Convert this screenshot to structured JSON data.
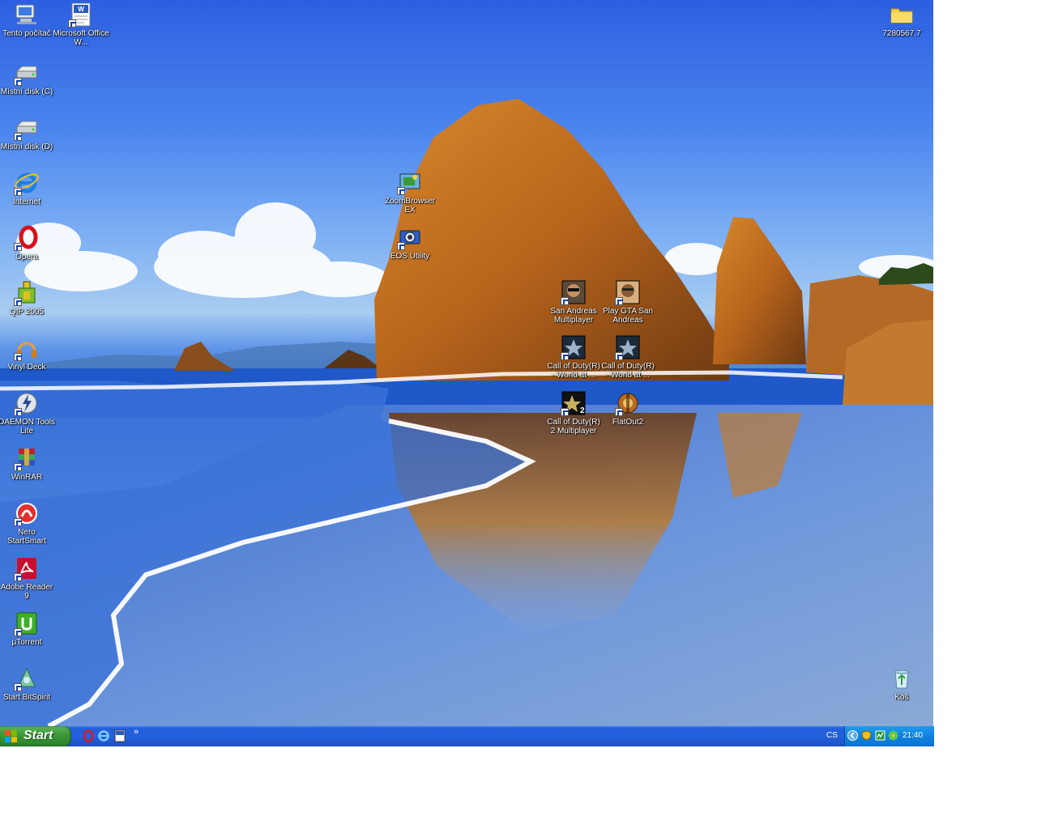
{
  "desktop": {
    "icons": [
      {
        "label": "Tento počítač",
        "icon": "my-computer-icon"
      },
      {
        "label": "Microsoft Office W...",
        "icon": "word-icon"
      },
      {
        "label": "Místní disk (C)",
        "icon": "hard-drive-icon"
      },
      {
        "label": "Místní disk (D)",
        "icon": "hard-drive-icon"
      },
      {
        "label": "Internet",
        "icon": "internet-explorer-icon"
      },
      {
        "label": "Opera",
        "icon": "opera-icon"
      },
      {
        "label": "QIP 2005",
        "icon": "qip-icon"
      },
      {
        "label": "Vinyl Deck",
        "icon": "headphones-icon"
      },
      {
        "label": "DAEMON Tools Lite",
        "icon": "daemon-tools-icon"
      },
      {
        "label": "WinRAR",
        "icon": "winrar-icon"
      },
      {
        "label": "Nero StartSmart",
        "icon": "nero-icon"
      },
      {
        "label": "Adobe Reader 9",
        "icon": "adobe-reader-icon"
      },
      {
        "label": "µTorrent",
        "icon": "utorrent-icon"
      },
      {
        "label": "Start BitSpirit",
        "icon": "bitspirit-icon"
      },
      {
        "label": "ZoomBrowser EX",
        "icon": "zoombrowser-icon"
      },
      {
        "label": "EOS Utility",
        "icon": "eos-utility-icon"
      },
      {
        "label": "San Andreas Multiplayer",
        "icon": "gta-icon"
      },
      {
        "label": "Play GTA San Andreas",
        "icon": "gta-icon"
      },
      {
        "label": "Call of Duty(R) - World at ...",
        "icon": "cod-icon"
      },
      {
        "label": "Call of Duty(R) - World at ...",
        "icon": "cod-icon"
      },
      {
        "label": "Call of Duty(R) 2 Multiplayer",
        "icon": "cod2-icon"
      },
      {
        "label": "FlatOut2",
        "icon": "flatout-icon"
      },
      {
        "label": "7280567.7",
        "icon": "folder-icon"
      },
      {
        "label": "Koš",
        "icon": "recycle-bin-icon"
      }
    ]
  },
  "taskbar": {
    "start_label": "Start",
    "quick_launch": [
      "opera-icon",
      "internet-explorer-icon",
      "word-icon"
    ],
    "more": "»",
    "language": "CS",
    "clock": "21:40",
    "tray_icons": [
      "arrow-left-icon",
      "shield-icon",
      "network-icon",
      "icq-flower-icon"
    ]
  },
  "colors": {
    "taskbar": "#245edb",
    "start": "#3c9a38",
    "tray": "#0f82e0"
  }
}
